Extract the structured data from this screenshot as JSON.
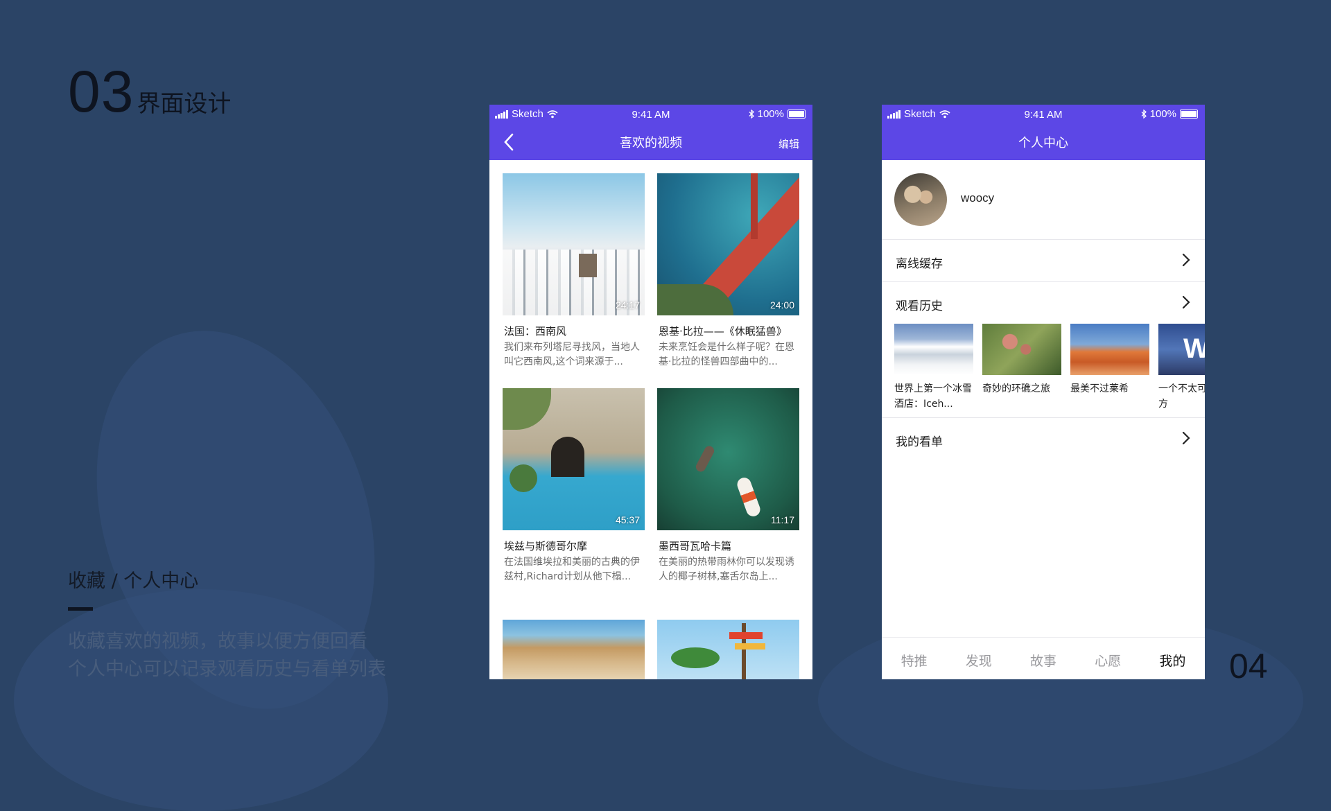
{
  "slide": {
    "number": "03",
    "heading": "界面设计",
    "label": "收藏 / 个人中心",
    "desc_line1": "收藏喜欢的视频，故事以便方便回看",
    "desc_line2": "个人中心可以记录观看历史与看单列表",
    "page_number": "04"
  },
  "status_bar": {
    "carrier": "Sketch",
    "time": "9:41 AM",
    "battery": "100%"
  },
  "favorites": {
    "title": "喜欢的视频",
    "edit_label": "编辑",
    "cards": [
      {
        "title": "法国：西南风",
        "desc": "我们来布列塔尼寻找风，当地人叫它西南风,这个词来源于...",
        "duration": "24:17",
        "image": "santorini-white-village"
      },
      {
        "title": "恩基·比拉——《休眠猛兽》",
        "desc": "未来烹饪会是什么样子呢？在恩基·比拉的怪兽四部曲中的...",
        "duration": "24:00",
        "image": "golden-gate-bridge"
      },
      {
        "title": "埃兹与斯德哥尔摩",
        "desc": "在法国维埃拉和美丽的古典的伊兹村,Richard计划从他下榻...",
        "duration": "45:37",
        "image": "courtyard-pool"
      },
      {
        "title": "墨西哥瓦哈卡篇",
        "desc": "在美丽的热带雨林你可以发现诱人的椰子树林,塞舌尔岛上...",
        "duration": "11:17",
        "image": "koi-pond"
      },
      {
        "title": "",
        "desc": "",
        "duration": "",
        "image": "beach-cliffs"
      },
      {
        "title": "",
        "desc": "",
        "duration": "",
        "image": "palm-signpost"
      }
    ]
  },
  "profile": {
    "title": "个人中心",
    "username": "woocy",
    "offline_cache": "离线缓存",
    "watch_history": "观看历史",
    "history_items": [
      {
        "title": "世界上第一个冰雪酒店：Iceh...",
        "image": "snowy-mountains"
      },
      {
        "title": "奇妙的环礁之旅",
        "image": "coral-reef"
      },
      {
        "title": "最美不过莱希",
        "image": "desert-butte"
      },
      {
        "title": "一个不太可能的地方",
        "image": "w-hotel"
      }
    ],
    "watch_list": "我的看单"
  },
  "tabbar": {
    "tabs": [
      {
        "label": "特推",
        "active": false
      },
      {
        "label": "发现",
        "active": false
      },
      {
        "label": "故事",
        "active": false
      },
      {
        "label": "心愿",
        "active": false
      },
      {
        "label": "我的",
        "active": true
      }
    ]
  },
  "colors": {
    "background": "#2b4466",
    "accent": "#5c47e6",
    "text_dark": "#0e1420"
  }
}
